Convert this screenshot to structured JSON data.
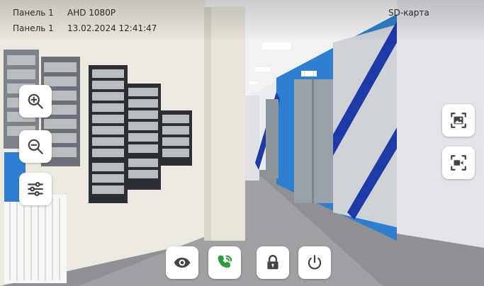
{
  "status": {
    "line1": {
      "panel": "Панель 1",
      "value": "AHD 1080P"
    },
    "line2": {
      "panel": "Панель 1",
      "value": "13.02.2024 12:41:47"
    },
    "storage": "SD-карта"
  },
  "controls": {
    "left": [
      "zoom-in-icon",
      "zoom-out-icon",
      "sliders-icon"
    ],
    "right": [
      "image-icon",
      "video-camera-icon"
    ],
    "bottom": [
      "eye-icon",
      "phone-call-icon",
      "lock-icon",
      "power-icon"
    ]
  },
  "colors": {
    "talk_accent": "#2e9b3f",
    "button_bg": "#ffffff",
    "icon_dark": "#444444",
    "wall_blue": "#2f7fd0",
    "stripe_navy": "#1e3aa8"
  }
}
